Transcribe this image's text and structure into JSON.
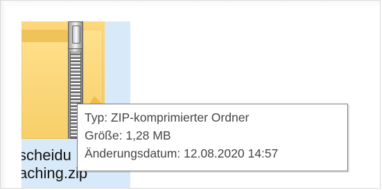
{
  "window": {
    "background": "#ffffff",
    "border_color": "#d9d9d9"
  },
  "file_item": {
    "selection_color": "#d8eaf9",
    "icon": "zip-folder-icon",
    "name_line_1": "scheidu",
    "name_line_2": "aching.zip"
  },
  "tooltip": {
    "type_line": "Typ: ZIP-komprimierter Ordner",
    "size_line": "Größe: 1,28 MB",
    "modified_line": "Änderungsdatum: 12.08.2020 14:57",
    "border_color": "#767676",
    "text_color": "#444444"
  }
}
